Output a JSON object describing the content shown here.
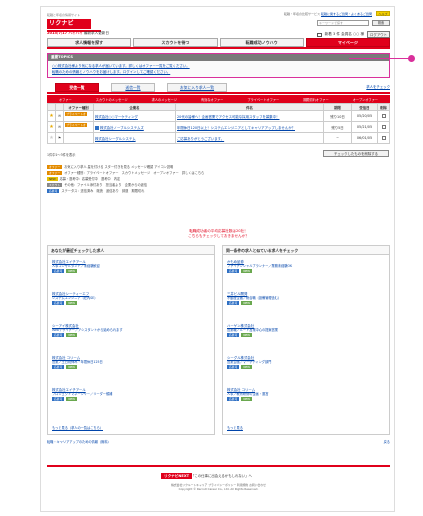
{
  "header": {
    "logo_sub": "転職と年収の情報サイト",
    "logo": "リクナビNEXT",
    "top_right_text": "転職・年収の比較サービス ",
    "top_right_link": "転職に関するご質問・よくあるご質問",
    "help_label": "ヘルプ",
    "search_placeholder": "キーワードで探す",
    "search_button": "検索",
    "date_text": "2015/7/17 バイバイ",
    "date_highlight": "最新求人更新日",
    "user_text": "新着 3 件  会員名 ○○ 様",
    "logout_label": "ログアウト"
  },
  "gnav": [
    {
      "label": "求人情報を探す"
    },
    {
      "label": "スカウトを待つ"
    },
    {
      "label": "転職成功ノウハウ"
    },
    {
      "label": "マイページ"
    }
  ],
  "topics": {
    "heading": "重要TOPICS",
    "items": [
      "○○株式会社様より気になる求人が届いています。詳しくはオファー一覧をご覧ください。",
      "転職のための情報とノウハウをお届けします。ログインしてご確認ください。"
    ]
  },
  "tabs": {
    "items": [
      "受信一覧",
      "送信一覧",
      "お気に入り求人一覧"
    ],
    "right_link": "求人をチェック"
  },
  "filters": [
    "オファー",
    "スカウトのメッセージ",
    "求人のメッセージ",
    "有効なオファー",
    "プライベートオファー",
    "期限切れオファー",
    "オープンオファー"
  ],
  "table": {
    "headers": [
      "",
      "",
      "オファー種別",
      "企業名",
      "件名",
      "期限",
      "受信日",
      "削除"
    ],
    "rows": [
      {
        "offer": "プライベートオファー",
        "company": "株式会社○○マーケティング",
        "subject": "20代の皆様へ！企画営業でアクセス可能な採用スタッフを募集中！",
        "deadline": "残り10日",
        "received": "05/20/05",
        "starred": true
      },
      {
        "offer": "プライベートオファー",
        "company": "株式会社ノーブルシステムズ",
        "subject": "年間休日120日以上！システムエンジニアとしてキャリアアップしませんか？",
        "deadline": "残り5日",
        "received": "05/21/05",
        "starred": true
      },
      {
        "offer": "",
        "company": "株式会社シーグルシステム",
        "subject": "ご応募ありがとうございます。",
        "deadline": "−",
        "received": "06/01/05",
        "starred": false
      }
    ],
    "delete_button": "チェックしたものを削除する",
    "count_text": "1件中1〜3件を表示"
  },
  "legend": [
    "お気に入り求人  星を付ける  スター付きを見る  メッセージ確認  アイコン説明",
    "オファー種別：プライベートオファー　スカウトメッセージ　オープンオファー　詳しくはこちら",
    "応募・選考中：応募受付中　選考中　内定",
    "その他：ファイル添付あり　担当者より　企業からの返信",
    "ステータス：送信済み　既読　返信あり　辞退　期限切れ"
  ],
  "promo": {
    "line1": "転職成功者の平均応募社数は20社！",
    "line2": "こちらもチェックしておきませんか？"
  },
  "left_col": {
    "title": "あなたが最近チェックした求人",
    "items": [
      {
        "company": "株式会社エイチアール",
        "desc": "人事コンサルタント／未経験歓迎"
      },
      {
        "company": "株式会社シーティーエフ",
        "desc": "システムエンジニア（社内SE）"
      },
      {
        "company": "シーアイ株式会社",
        "desc": "Webデザイナー／アシスタントから始められます"
      },
      {
        "company": "株式会社 コリーム",
        "desc": "営業／土日祝休み・年間休日125日"
      },
      {
        "company": "株式会社エイチアール",
        "desc": "プロジェクトマネージャー／リーダー候補"
      }
    ],
    "more": "もっと見る（求人の一覧はこちら）"
  },
  "right_col": {
    "title": "同一条件の求人と似ている求人をチェック",
    "items": [
      {
        "company": "かもめ証券",
        "desc": "ファイナンシャルプランナー／業務未経験OK"
      },
      {
        "company": "三井ビル開発",
        "desc": "不動産企画／総合職（設備管理含む）"
      },
      {
        "company": "ハーゲン株式会社",
        "desc": "営業職／ルート営業中心の提案営業"
      },
      {
        "company": "シーグル株式会社",
        "desc": "営業企画／マーケティング部門"
      },
      {
        "company": "株式会社 コリーム",
        "desc": "人事／教育研修の企画・運営"
      }
    ],
    "more": "もっと見る"
  },
  "chips": {
    "offer": "オファー",
    "scout": "スカウト",
    "new": "NEW",
    "app": "応募可"
  },
  "bottom_links": [
    "転職・キャリアアップのための情報（無料）",
    "戻る"
  ],
  "footer": {
    "logo": "リクナビNEXT",
    "tagline": "「この仕事に出会えるかもしれない」へ",
    "text1": "株式会社リクルートキャリア  プライバシーポリシー  利用規約  お問い合わせ",
    "text2": "Copyright © Recruit Career Co., Ltd. All Rights Reserved."
  }
}
